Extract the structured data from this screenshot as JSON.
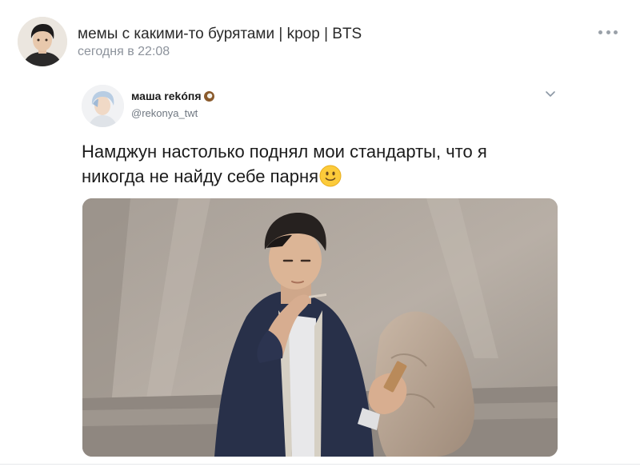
{
  "post": {
    "group_name": "мемы с какими-то бурятами | kpop | BTS",
    "time": "сегодня в 22:08"
  },
  "tweet": {
    "author_name": "маша rekóпя",
    "handle": "@rekonya_twt",
    "text": "Намджун настолько поднял мои стандарты, что я никогда не найду себе парня"
  },
  "icons": {
    "more": "more-dots-icon",
    "chevron": "chevron-down-icon",
    "emoji_name": "coconut-emoji",
    "emoji_text": "slightly-smiling-face-emoji"
  },
  "colors": {
    "text": "#1b1b1b",
    "meta": "#8d939c",
    "handle": "#6f7781"
  }
}
